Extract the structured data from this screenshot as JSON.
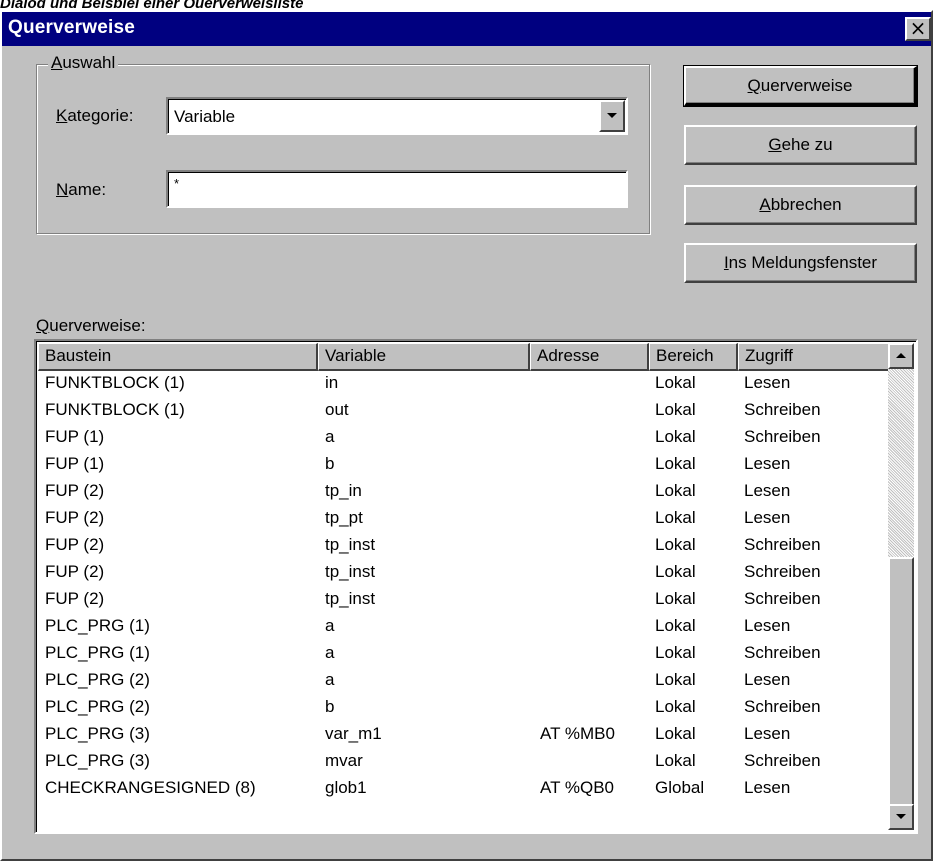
{
  "caption": "Dialog und Beispiel einer Querverweisliste",
  "dialog": {
    "title": "Querverweise",
    "close_glyph": "×"
  },
  "selection": {
    "group_label": {
      "pre": "",
      "u": "A",
      "post": "uswahl"
    },
    "category_label": {
      "pre": "",
      "u": "K",
      "post": "ategorie:"
    },
    "category_value": "Variable",
    "name_label": {
      "pre": "",
      "u": "N",
      "post": "ame:"
    },
    "name_value": "*"
  },
  "buttons": [
    {
      "pre": "",
      "u": "Q",
      "post": "uerverweise"
    },
    {
      "pre": "",
      "u": "G",
      "post": "ehe zu"
    },
    {
      "pre": "",
      "u": "A",
      "post": "bbrechen"
    },
    {
      "pre": "",
      "u": "I",
      "post": "ns Meldungsfenster"
    }
  ],
  "list_label": {
    "pre": "",
    "u": "Q",
    "post": "uerverweise:"
  },
  "columns": [
    "Baustein",
    "Variable",
    "Adresse",
    "Bereich",
    "Zugriff"
  ],
  "rows": [
    [
      "FUNKTBLOCK (1)",
      "in",
      "",
      "Lokal",
      "Lesen"
    ],
    [
      "FUNKTBLOCK (1)",
      "out",
      "",
      "Lokal",
      "Schreiben"
    ],
    [
      "FUP (1)",
      "a",
      "",
      "Lokal",
      "Schreiben"
    ],
    [
      "FUP (1)",
      "b",
      "",
      "Lokal",
      "Lesen"
    ],
    [
      "FUP (2)",
      "tp_in",
      "",
      "Lokal",
      "Lesen"
    ],
    [
      "FUP (2)",
      "tp_pt",
      "",
      "Lokal",
      "Lesen"
    ],
    [
      "FUP (2)",
      "tp_inst",
      "",
      "Lokal",
      "Schreiben"
    ],
    [
      "FUP (2)",
      "tp_inst",
      "",
      "Lokal",
      "Schreiben"
    ],
    [
      "FUP (2)",
      "tp_inst",
      "",
      "Lokal",
      "Schreiben"
    ],
    [
      "PLC_PRG (1)",
      "a",
      "",
      "Lokal",
      "Lesen"
    ],
    [
      "PLC_PRG (1)",
      "a",
      "",
      "Lokal",
      "Schreiben"
    ],
    [
      "PLC_PRG (2)",
      "a",
      "",
      "Lokal",
      "Lesen"
    ],
    [
      "PLC_PRG (2)",
      "b",
      "",
      "Lokal",
      "Schreiben"
    ],
    [
      "PLC_PRG (3)",
      "var_m1",
      "AT %MB0",
      "Lokal",
      "Lesen"
    ],
    [
      "PLC_PRG (3)",
      "mvar",
      "",
      "Lokal",
      "Schreiben"
    ],
    [
      "CHECKRANGESIGNED (8)",
      "glob1",
      "AT %QB0",
      "Global",
      "Lesen"
    ]
  ],
  "colors": {
    "titlebar": "#000080",
    "face": "#c0c0c0"
  }
}
